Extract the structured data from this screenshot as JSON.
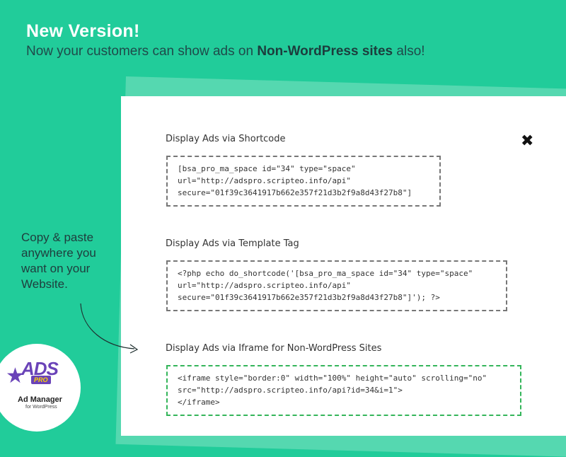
{
  "header": {
    "headline": "New Version!",
    "sub_prefix": "Now your customers can show ads on ",
    "sub_bold": "Non-WordPress sites",
    "sub_suffix": " also!"
  },
  "sections": [
    {
      "title": "Display Ads via Shortcode",
      "code": "[bsa_pro_ma_space id=\"34\" type=\"space\"\nurl=\"http://adspro.scripteo.info/api\"\nsecure=\"01f39c3641917b662e357f21d3b2f9a8d43f27b8\"]"
    },
    {
      "title": "Display Ads via Template Tag",
      "code": "<?php echo do_shortcode('[bsa_pro_ma_space id=\"34\" type=\"space\"\nurl=\"http://adspro.scripteo.info/api\"\nsecure=\"01f39c3641917b662e357f21d3b2f9a8d43f27b8\"]'); ?>"
    },
    {
      "title": "Display Ads via Iframe for Non-WordPress Sites",
      "code": "<iframe style=\"border:0\" width=\"100%\" height=\"auto\" scrolling=\"no\"\nsrc=\"http://adspro.scripteo.info/api?id=34&i=1\">\n</iframe>"
    }
  ],
  "tip": "Copy & paste anywhere you want on your Website.",
  "close_icon": "×",
  "logo": {
    "brand": "ADS",
    "badge": "PRO",
    "name": "Ad Manager",
    "subtitle": "for WordPress"
  },
  "colors": {
    "background": "#21cc9a",
    "accent_purple": "#6a43b8",
    "green_border": "#34b55a"
  }
}
